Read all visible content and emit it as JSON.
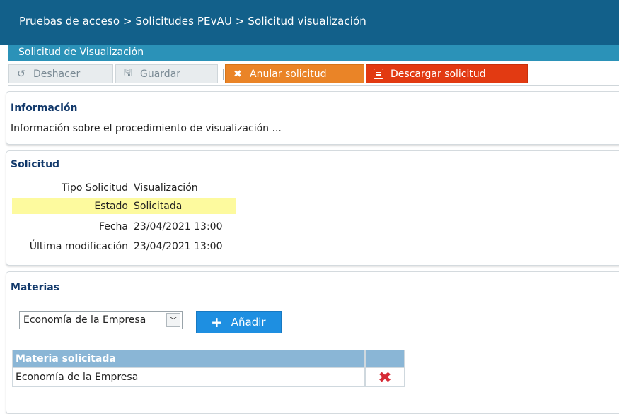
{
  "breadcrumb": "Pruebas de acceso > Solicitudes PEvAU > Solicitud visualización",
  "subtitle": "Solicitud de Visualización",
  "toolbar": {
    "undo_label": "Deshacer",
    "save_label": "Guardar",
    "cancel_label": "Anular solicitud",
    "download_label": "Descargar solicitud"
  },
  "info": {
    "title": "Información",
    "text": "Información sobre el procedimiento de visualización ..."
  },
  "solicitud": {
    "title": "Solicitud",
    "fields": [
      {
        "label": "Tipo Solicitud",
        "value": "Visualización"
      },
      {
        "label": "Estado",
        "value": "Solicitada"
      },
      {
        "label": "Fecha",
        "value": "23/04/2021 13:00"
      },
      {
        "label": "Última modificación",
        "value": "23/04/2021 13:00"
      }
    ]
  },
  "materias": {
    "title": "Materias",
    "select_value": "Economía de la Empresa",
    "add_label": "Añadir",
    "table": {
      "headers": [
        "Materia solicitada",
        ""
      ],
      "rows": [
        [
          "Economía de la Empresa"
        ]
      ]
    }
  },
  "colors": {
    "header_bg": "#12608a",
    "subheader_bg": "#2b92b8",
    "cancel_bg": "#ea8427",
    "download_bg": "#e23a12",
    "add_bg": "#1e8fe1",
    "highlight": "#fdfa9e"
  }
}
